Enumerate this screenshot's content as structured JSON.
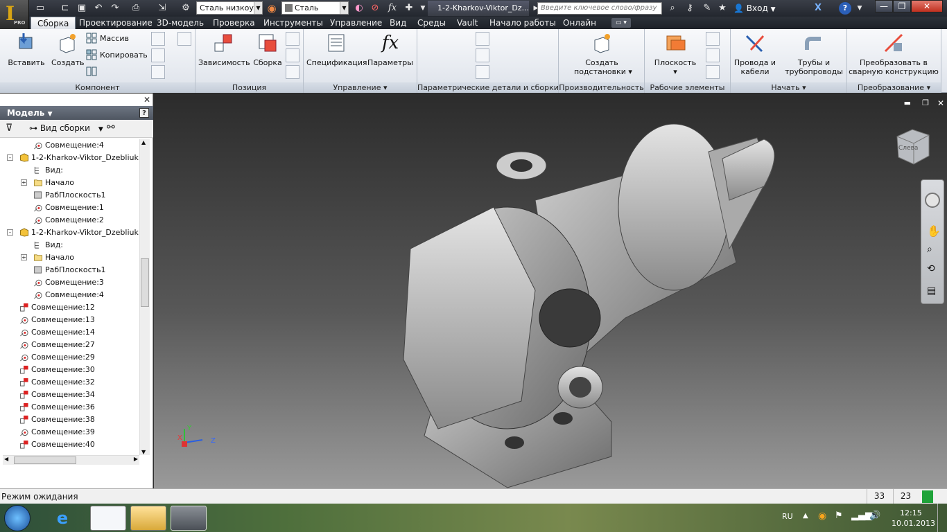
{
  "app": {
    "logo_letter": "I",
    "edition": "PRO"
  },
  "titlebar": {
    "material_value": "Сталь низкоу",
    "appearance_value": "Сталь",
    "doc_tab": "1-2-Kharkov-Viktor_Dz...",
    "search_placeholder": "Введите ключевое слово/фразу",
    "signin": "Вход",
    "help": "?"
  },
  "tabs": [
    "Сборка",
    "Проектирование",
    "3D-модель",
    "Проверка",
    "Инструменты",
    "Управление",
    "Вид",
    "Среды",
    "Vault",
    "Начало работы",
    "Онлайн"
  ],
  "ribbon": {
    "component": {
      "label": "Компонент",
      "insert": "Вставить",
      "create": "Создать",
      "pattern": "Массив",
      "copy": "Копировать"
    },
    "position": {
      "label": "Позиция",
      "constraints": "Зависимость",
      "assemble": "Сборка"
    },
    "manage": {
      "label": "Управление",
      "bom": "Спецификация",
      "params": "Параметры"
    },
    "ipart": {
      "label": "Параметрические детали и сборки"
    },
    "productivity": {
      "label": "Производительность",
      "create_sub": "Создать",
      "create_sub2": "подстановки"
    },
    "work": {
      "label": "Рабочие элементы",
      "plane": "Плоскость"
    },
    "begin": {
      "label": "Начать",
      "cable": "Провода и",
      "cable2": "кабели",
      "tube": "Трубы и",
      "tube2": "трубопроводы"
    },
    "convert": {
      "label": "Преобразование",
      "weld": "Преобразовать в",
      "weld2": "сварную конструкцию"
    }
  },
  "browser": {
    "title": "Модель",
    "view": "Вид сборки",
    "nodes": [
      {
        "t": "Совмещение:4",
        "lvl": 3,
        "ic": "mate"
      },
      {
        "t": "1-2-Kharkov-Viktor_Dzebliuk",
        "lvl": 2,
        "ic": "part",
        "exp": "-"
      },
      {
        "t": "Вид:",
        "lvl": 3,
        "ic": "view"
      },
      {
        "t": "Начало",
        "lvl": 3,
        "ic": "folder",
        "exp": "+"
      },
      {
        "t": "РабПлоскость1",
        "lvl": 3,
        "ic": "plane"
      },
      {
        "t": "Совмещение:1",
        "lvl": 3,
        "ic": "mate"
      },
      {
        "t": "Совмещение:2",
        "lvl": 3,
        "ic": "mate"
      },
      {
        "t": "1-2-Kharkov-Viktor_Dzebliuk",
        "lvl": 2,
        "ic": "part",
        "exp": "-"
      },
      {
        "t": "Вид:",
        "lvl": 3,
        "ic": "view"
      },
      {
        "t": "Начало",
        "lvl": 3,
        "ic": "folder",
        "exp": "+"
      },
      {
        "t": "РабПлоскость1",
        "lvl": 3,
        "ic": "plane"
      },
      {
        "t": "Совмещение:3",
        "lvl": 3,
        "ic": "mate"
      },
      {
        "t": "Совмещение:4",
        "lvl": 3,
        "ic": "mate"
      },
      {
        "t": "Совмещение:12",
        "lvl": 2,
        "ic": "flush"
      },
      {
        "t": "Совмещение:13",
        "lvl": 2,
        "ic": "mate"
      },
      {
        "t": "Совмещение:14",
        "lvl": 2,
        "ic": "mate"
      },
      {
        "t": "Совмещение:27",
        "lvl": 2,
        "ic": "mate"
      },
      {
        "t": "Совмещение:29",
        "lvl": 2,
        "ic": "mate"
      },
      {
        "t": "Совмещение:30",
        "lvl": 2,
        "ic": "flush"
      },
      {
        "t": "Совмещение:32",
        "lvl": 2,
        "ic": "flush"
      },
      {
        "t": "Совмещение:34",
        "lvl": 2,
        "ic": "flush"
      },
      {
        "t": "Совмещение:36",
        "lvl": 2,
        "ic": "flush"
      },
      {
        "t": "Совмещение:38",
        "lvl": 2,
        "ic": "flush"
      },
      {
        "t": "Совмещение:39",
        "lvl": 2,
        "ic": "mate"
      },
      {
        "t": "Совмещение:40",
        "lvl": 2,
        "ic": "flush"
      }
    ]
  },
  "viewcube": {
    "face": "Слева"
  },
  "axes": {
    "x": "X",
    "y": "Y",
    "z": "Z"
  },
  "status": {
    "text": "Режим ожидания",
    "count1": "33",
    "count2": "23"
  },
  "taskbar": {
    "lang": "RU",
    "time": "12:15",
    "date": "10.01.2013"
  },
  "colors": {
    "accent": "#2a6ad3",
    "status_green": "#1fa339"
  }
}
